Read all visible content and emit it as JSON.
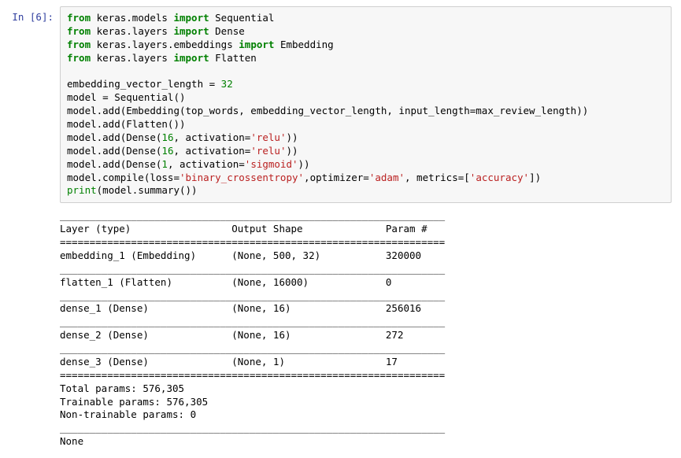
{
  "cell": {
    "prompt": "In [6]:",
    "code": {
      "l1_from": "from",
      "l1_mod": " keras.models ",
      "l1_import": "import",
      "l1_name": " Sequential",
      "l2_from": "from",
      "l2_mod": " keras.layers ",
      "l2_import": "import",
      "l2_name": " Dense",
      "l3_from": "from",
      "l3_mod": " keras.layers.embeddings ",
      "l3_import": "import",
      "l3_name": " Embedding",
      "l4_from": "from",
      "l4_mod": " keras.layers ",
      "l4_import": "import",
      "l4_name": " Flatten",
      "l5": "",
      "l6_a": "embedding_vector_length = ",
      "l6_num": "32",
      "l7": "model = Sequential()",
      "l8": "model.add(Embedding(top_words, embedding_vector_length, input_length=max_review_length))",
      "l9": "model.add(Flatten())",
      "l10_a": "model.add(Dense(",
      "l10_n": "16",
      "l10_b": ", activation=",
      "l10_s": "'relu'",
      "l10_c": "))",
      "l11_a": "model.add(Dense(",
      "l11_n": "16",
      "l11_b": ", activation=",
      "l11_s": "'relu'",
      "l11_c": "))",
      "l12_a": "model.add(Dense(",
      "l12_n": "1",
      "l12_b": ", activation=",
      "l12_s": "'sigmoid'",
      "l12_c": "))",
      "l13_a": "model.compile(loss=",
      "l13_s1": "'binary_crossentropy'",
      "l13_b": ",optimizer=",
      "l13_s2": "'adam'",
      "l13_c": ", metrics=[",
      "l13_s3": "'accuracy'",
      "l13_d": "])",
      "l14_print": "print",
      "l14_rest": "(model.summary())"
    }
  },
  "output": {
    "header": "Layer (type)                 Output Shape              Param #   ",
    "row1": "embedding_1 (Embedding)      (None, 500, 32)           320000    ",
    "row2": "flatten_1 (Flatten)          (None, 16000)             0         ",
    "row3": "dense_1 (Dense)              (None, 16)                256016    ",
    "row4": "dense_2 (Dense)              (None, 16)                272       ",
    "row5": "dense_3 (Dense)              (None, 1)                 17        ",
    "tot1": "Total params: 576,305",
    "tot2": "Trainable params: 576,305",
    "tot3": "Non-trainable params: 0",
    "none": "None",
    "underscore": "_________________________________________________________________",
    "equals": "================================================================="
  },
  "chart_data": {
    "type": "table",
    "title": "Keras model.summary()",
    "columns": [
      "Layer (type)",
      "Output Shape",
      "Param #"
    ],
    "rows": [
      [
        "embedding_1 (Embedding)",
        "(None, 500, 32)",
        320000
      ],
      [
        "flatten_1 (Flatten)",
        "(None, 16000)",
        0
      ],
      [
        "dense_1 (Dense)",
        "(None, 16)",
        256016
      ],
      [
        "dense_2 (Dense)",
        "(None, 16)",
        272
      ],
      [
        "dense_3 (Dense)",
        "(None, 1)",
        17
      ]
    ],
    "totals": {
      "Total params": 576305,
      "Trainable params": 576305,
      "Non-trainable params": 0
    }
  }
}
